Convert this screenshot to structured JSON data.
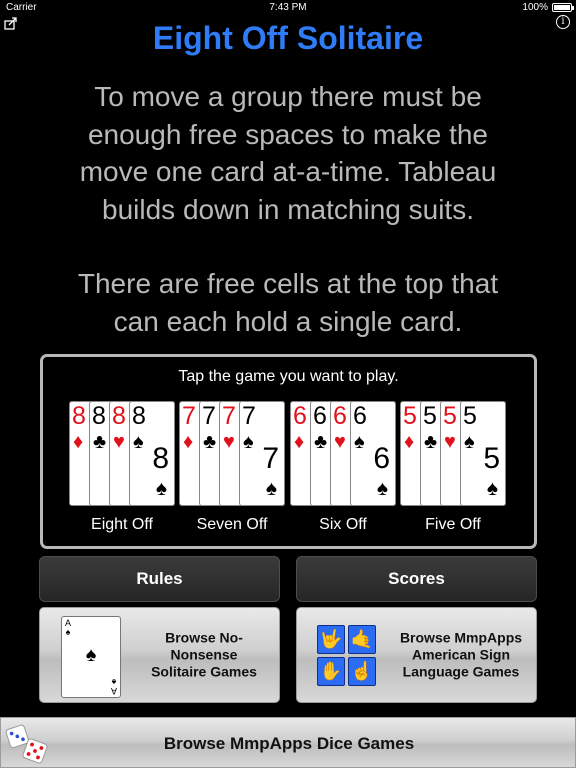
{
  "status_bar": {
    "carrier": "Carrier",
    "time": "7:43 PM",
    "battery": "100%",
    "battery_level": 1.0
  },
  "header": {
    "title": "Eight Off Solitaire",
    "share_icon": "share-icon",
    "info_icon": "info-icon",
    "info_glyph": "i"
  },
  "instructions": {
    "paragraph1": "To move a group there must be\nenough free spaces to make the\nmove one card at-a-time. Tableau\nbuilds down in matching suits.",
    "paragraph2": "There are free cells at the top that\ncan each hold a single card."
  },
  "game_panel": {
    "prompt": "Tap the game you want to play.",
    "games": [
      {
        "label": "Eight Off",
        "rank": "8",
        "cards": [
          {
            "suit": "♦",
            "color": "red"
          },
          {
            "suit": "♣",
            "color": "black"
          },
          {
            "suit": "♥",
            "color": "red"
          },
          {
            "suit": "♠",
            "color": "black"
          }
        ]
      },
      {
        "label": "Seven Off",
        "rank": "7",
        "cards": [
          {
            "suit": "♦",
            "color": "red"
          },
          {
            "suit": "♣",
            "color": "black"
          },
          {
            "suit": "♥",
            "color": "red"
          },
          {
            "suit": "♠",
            "color": "black"
          }
        ]
      },
      {
        "label": "Six Off",
        "rank": "6",
        "cards": [
          {
            "suit": "♦",
            "color": "red"
          },
          {
            "suit": "♣",
            "color": "black"
          },
          {
            "suit": "♥",
            "color": "red"
          },
          {
            "suit": "♠",
            "color": "black"
          }
        ]
      },
      {
        "label": "Five Off",
        "rank": "5",
        "cards": [
          {
            "suit": "♦",
            "color": "red"
          },
          {
            "suit": "♣",
            "color": "black"
          },
          {
            "suit": "♥",
            "color": "red"
          },
          {
            "suit": "♠",
            "color": "black"
          }
        ]
      }
    ]
  },
  "buttons": {
    "rules": "Rules",
    "scores": "Scores"
  },
  "promos": {
    "solitaire": {
      "text": "Browse No-\nNonsense\nSolitaire Games",
      "card_rank": "A",
      "card_suit": "♠"
    },
    "asl": {
      "text": "Browse MmpApps\nAmerican Sign\nLanguage Games",
      "signs": [
        "🤟",
        "🤙",
        "✋",
        "☝"
      ]
    }
  },
  "dice_bar": {
    "text": "Browse MmpApps Dice Games"
  },
  "colors": {
    "title_blue": "#2f7cf6",
    "instruction_gray": "#b9b9b9",
    "card_red": "#e1121b",
    "sign_tile_blue": "#2c6cf2"
  }
}
